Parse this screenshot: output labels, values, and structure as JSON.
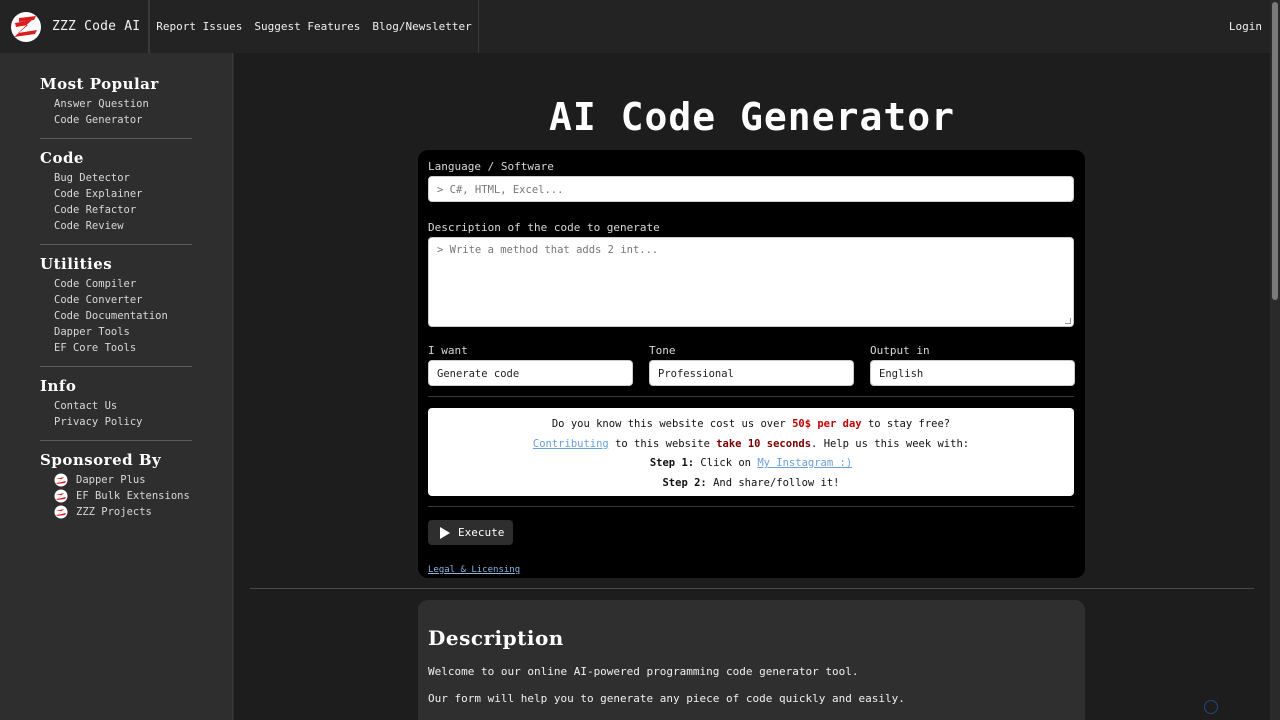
{
  "header": {
    "brand": "ZZZ Code AI",
    "nav": [
      "Report Issues",
      "Suggest Features",
      "Blog/Newsletter"
    ],
    "login": "Login"
  },
  "sidebar": {
    "sections": [
      {
        "heading": "Most Popular",
        "items": [
          "Answer Question",
          "Code Generator"
        ]
      },
      {
        "heading": "Code",
        "items": [
          "Bug Detector",
          "Code Explainer",
          "Code Refactor",
          "Code Review"
        ]
      },
      {
        "heading": "Utilities",
        "items": [
          "Code Compiler",
          "Code Converter",
          "Code Documentation",
          "Dapper Tools",
          "EF Core Tools"
        ]
      },
      {
        "heading": "Info",
        "items": [
          "Contact Us",
          "Privacy Policy"
        ]
      }
    ],
    "sponsored": {
      "heading": "Sponsored By",
      "items": [
        "Dapper Plus",
        "EF Bulk Extensions",
        "ZZZ Projects"
      ]
    }
  },
  "main": {
    "title": "AI Code Generator",
    "form": {
      "language_label": "Language / Software",
      "language_placeholder": "> C#, HTML, Excel...",
      "description_label": "Description of the code to generate",
      "description_placeholder": "> Write a method that adds 2 int...",
      "want_label": "I want",
      "want_value": "Generate code",
      "tone_label": "Tone",
      "tone_value": "Professional",
      "output_label": "Output in",
      "output_value": "English",
      "execute_label": "Execute",
      "legal_label": "Legal & Licensing"
    },
    "promo": {
      "line1_a": "Do you know this website cost us over ",
      "line1_b": "50$ per day",
      "line1_c": " to stay free?",
      "line2_link": "Contributing",
      "line2_a": " to this website ",
      "line2_b": "take 10 seconds",
      "line2_c": ". Help us this week with:",
      "step1_label": "Step 1:",
      "step1_text": " Click on ",
      "step1_link": "My Instagram :)",
      "step2_label": "Step 2:",
      "step2_text": " And share/follow it!"
    },
    "description": {
      "title": "Description",
      "p1": "Welcome to our online AI-powered programming code generator tool.",
      "p2": "Our form will help you to generate any piece of code quickly and easily."
    }
  },
  "colors": {
    "accent_red": "#c00000",
    "link_blue": "#6aa0d8",
    "logo_red": "#d81e1e"
  }
}
